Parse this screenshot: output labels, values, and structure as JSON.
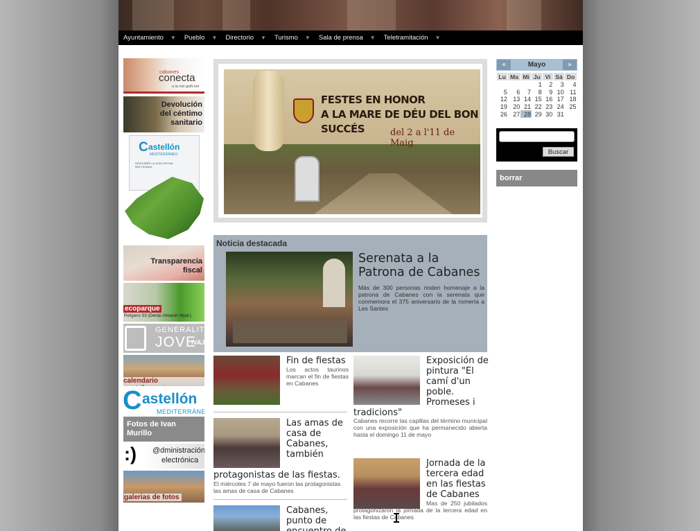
{
  "nav": {
    "items": [
      {
        "label": "Ayuntamiento"
      },
      {
        "label": "Pueblo"
      },
      {
        "label": "Directorio"
      },
      {
        "label": "Turismo"
      },
      {
        "label": "Sala de prensa"
      },
      {
        "label": "Teletramitación"
      }
    ],
    "arrow": "▼"
  },
  "sidebar": {
    "conecta": {
      "top": "cabanes",
      "main": "conecta",
      "sub": "a la red guifi.net"
    },
    "devolucion": "Devolución del céntimo sanitario",
    "castellon_guide": {
      "brand": "astellón",
      "sub": "MEDITERRÁNEO",
      "tagline": "DESCUBRE LA GUÍA OFICIAL MULTICANAL"
    },
    "transparencia": "Transparencia fiscal",
    "ecoparque": {
      "title": "ecoparque",
      "sub": "Polígono S3 (Detrás Almacén Mpal.)"
    },
    "generalitat": {
      "line1": "GENERALITAT",
      "line2": "JOVE",
      "tag": "IVAJ"
    },
    "calendario": "calendario contribuyente",
    "castellon": {
      "brand": "astellón",
      "sub": "MEDITERRÁNEO"
    },
    "fotos_ivan": "Fotos de Ivan Murillo",
    "admin": {
      "smile": ":)",
      "line1": "@dministración",
      "line2": "electrónica"
    },
    "galerias": "galerias de fotos"
  },
  "poster": {
    "line1": "FESTES EN HONOR",
    "line2": "A LA MARE DE DÉU DEL BON SUCCÉS",
    "dates": "del 2 a l'11 de Maig"
  },
  "featured": {
    "heading": "Noticia destacada",
    "title": "Serenata a la Patrona de Cabanes",
    "desc": "Más de 300 personas rinden homenaje a la patrona de Cabanes con la serenata que conmemora el 375 aniversario de la romería a Les Santes"
  },
  "news": [
    {
      "title": "Fin de fiestas",
      "desc": "Los actos taurinos marcan el fin de fiestas en Cabanes"
    },
    {
      "title": "Las amas de casa de Cabanes, también",
      "title_tail": "protagonistas de las fiestas.",
      "desc": "El miércoles 7 de mayo fueron las protagonistas las amas de casa de Cabanes"
    },
    {
      "title": "Cabanes, punto de encuentro de"
    },
    {
      "title": "Exposición de pintura \"El camí d'un poble. Promeses i",
      "title_tail": "tradicions\"",
      "desc": "Cabanes recorre las capillas del término municipal con una exposición que ha permanecido abierta hasta el domingo 11 de mayo"
    },
    {
      "title": "Jornada de la tercera edad en las fiestas de Cabanes",
      "desc": "Mas de 250 jubilados protagonizaron la jornada de la tercera edad en las fiestas de Cabanes"
    }
  ],
  "calendar": {
    "month": "Mayo",
    "prev": "«",
    "next": "»",
    "days": [
      "Lu",
      "Ma",
      "Mi",
      "Ju",
      "Vi",
      "Sá",
      "Do"
    ],
    "weeks": [
      [
        "",
        "",
        "",
        "1",
        "2",
        "3",
        "4"
      ],
      [
        "5",
        "6",
        "7",
        "8",
        "9",
        "10",
        "11"
      ],
      [
        "12",
        "13",
        "14",
        "15",
        "16",
        "17",
        "18"
      ],
      [
        "19",
        "20",
        "21",
        "22",
        "23",
        "24",
        "25"
      ],
      [
        "26",
        "27",
        "28",
        "29",
        "30",
        "31",
        ""
      ]
    ],
    "today": "28"
  },
  "search": {
    "button": "Buscar",
    "value": ""
  },
  "borrar": "borrar",
  "colors": {
    "nav_bg": "#000000",
    "featured_bg": "#a5b0ba",
    "calendar_accent": "#a9bfd2"
  }
}
